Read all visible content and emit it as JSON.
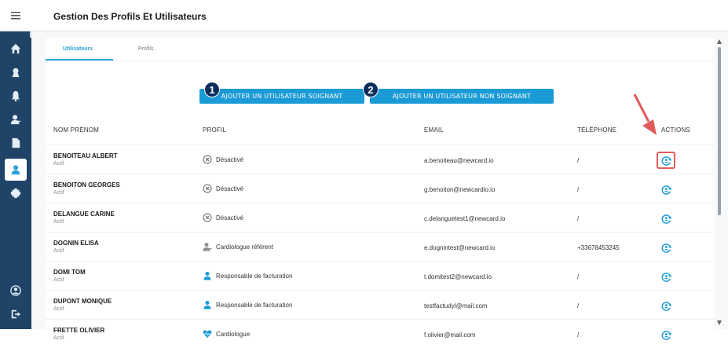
{
  "app": {
    "page_title": "Gestion Des Profils Et Utilisateurs",
    "menu_icon": "hamburger-icon"
  },
  "sidebar": {
    "items": [
      {
        "icon": "home-icon"
      },
      {
        "icon": "profile-badge-icon"
      },
      {
        "icon": "bell-icon"
      },
      {
        "icon": "user-doctor-icon"
      },
      {
        "icon": "document-icon"
      },
      {
        "icon": "users-icon",
        "active": true
      },
      {
        "icon": "settings-icon"
      },
      {
        "icon": "account-circle-icon"
      },
      {
        "icon": "logout-icon"
      }
    ]
  },
  "tabs": [
    {
      "label": "Utilisateurs",
      "active": true
    },
    {
      "label": "Profils",
      "active": false
    }
  ],
  "buttons": {
    "add_soignant": "AJOUTER UN UTILISATEUR SOIGNANT",
    "add_non_soignant": "AJOUTER UN UTILISATEUR NON SOIGNANT",
    "badge_1": "1",
    "badge_2": "2"
  },
  "table": {
    "headers": {
      "name": "NOM PRÉNOM",
      "profil": "PROFIL",
      "email": "EMAIL",
      "phone": "TÉLÉPHONE",
      "actions": "ACTIONS"
    },
    "rows": [
      {
        "name": "BENOITEAU ALBERT",
        "status": "Actif",
        "profil": "Désactivé",
        "profil_icon": "cross-circle-icon",
        "email": "a.benoiteau@newcard.io",
        "phone": "/",
        "highlight": true
      },
      {
        "name": "BENOITON GEORGES",
        "status": "Actif",
        "profil": "Désactivé",
        "profil_icon": "cross-circle-icon",
        "email": "g.benoiton@newcardio.io",
        "phone": "/"
      },
      {
        "name": "DELANGUE CARINE",
        "status": "Actif",
        "profil": "Désactivé",
        "profil_icon": "cross-circle-icon",
        "email": "c.delanguetest1@newcard.io",
        "phone": "/"
      },
      {
        "name": "DOGNIN ELISA",
        "status": "Actif",
        "profil": "Cardiologue référent",
        "profil_icon": "user-doctor-icon",
        "email": "e.dognintest@newcard.io",
        "phone": "+33678453245"
      },
      {
        "name": "DOMI TOM",
        "status": "Actif",
        "profil": "Responsable de facturation",
        "profil_icon": "person-icon",
        "email": "t.domitest2@newcard.io",
        "phone": "/"
      },
      {
        "name": "DUPONT MONIQUE",
        "status": "Actif",
        "profil": "Responsable de facturation",
        "profil_icon": "person-icon",
        "email": "testfactudyl@mail.com",
        "phone": "/"
      },
      {
        "name": "FRETTE OLIVIER",
        "status": "Actif",
        "profil": "Cardiologue",
        "profil_icon": "heart-pulse-icon",
        "email": "f.olivier@mail.com",
        "phone": "/"
      }
    ]
  },
  "colors": {
    "sidebar_bg": "#1f4468",
    "accent": "#1b9bd6",
    "badge_bg": "#0d2d5c",
    "highlight": "#e05a5a"
  }
}
